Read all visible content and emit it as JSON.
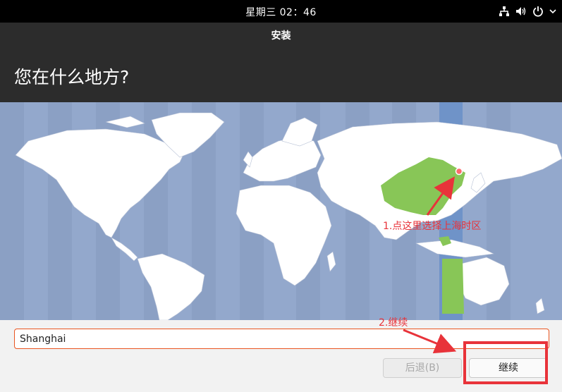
{
  "topbar": {
    "clock": "星期三 02：46",
    "icons": [
      "network-icon",
      "volume-icon",
      "power-icon",
      "chevron-down-icon"
    ]
  },
  "window": {
    "title": "安装",
    "heading": "您在什么地方?"
  },
  "map": {
    "colors": {
      "ocean": "#93a8cc",
      "land": "#ffffff",
      "highlight": "#88c657",
      "selected_band": "#6f93c8"
    },
    "selected_marker": "pin-icon"
  },
  "location_input": {
    "value": "Shanghai"
  },
  "buttons": {
    "back": "后退(B)",
    "continue": "继续"
  },
  "annotations": {
    "step1": "1.点这里选择上海时区",
    "step2": "2.继续",
    "color": "#e8333a"
  }
}
